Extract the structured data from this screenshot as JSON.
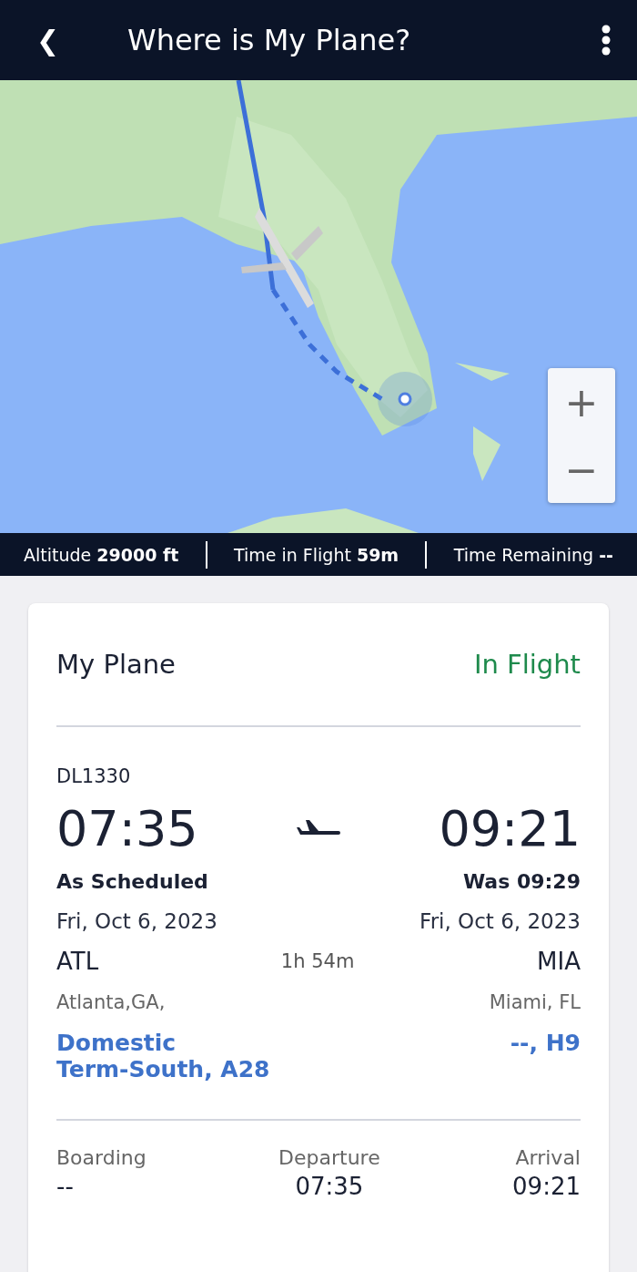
{
  "header": {
    "back": "❮",
    "title": "Where is My Plane?"
  },
  "map": {
    "kind": "picture",
    "zoom_in": "+",
    "zoom_out": "−"
  },
  "stats": [
    {
      "label": "Altitude",
      "value": "29000 ft"
    },
    {
      "label": "Time in Flight",
      "value": "59m"
    },
    {
      "label": "Time Remaining",
      "value": "--"
    }
  ],
  "card": {
    "title": "My Plane",
    "status": "In Flight",
    "flight": "DL1330",
    "departure": {
      "time": "07:35",
      "note": "As Scheduled",
      "date": "Fri, Oct 6, 2023",
      "code": "ATL",
      "city": "Atlanta,GA,",
      "terminal_lines": [
        "Domestic",
        "Term-South, A28"
      ]
    },
    "duration": "1h 54m",
    "arrival": {
      "time": "09:21",
      "note": "Was 09:29",
      "date": "Fri, Oct 6, 2023",
      "code": "MIA",
      "city": "Miami, FL",
      "terminal": "--, H9"
    },
    "times": [
      {
        "label": "Boarding",
        "value": "--"
      },
      {
        "label": "Departure",
        "value": "07:35"
      },
      {
        "label": "Arrival",
        "value": "09:21"
      }
    ]
  }
}
